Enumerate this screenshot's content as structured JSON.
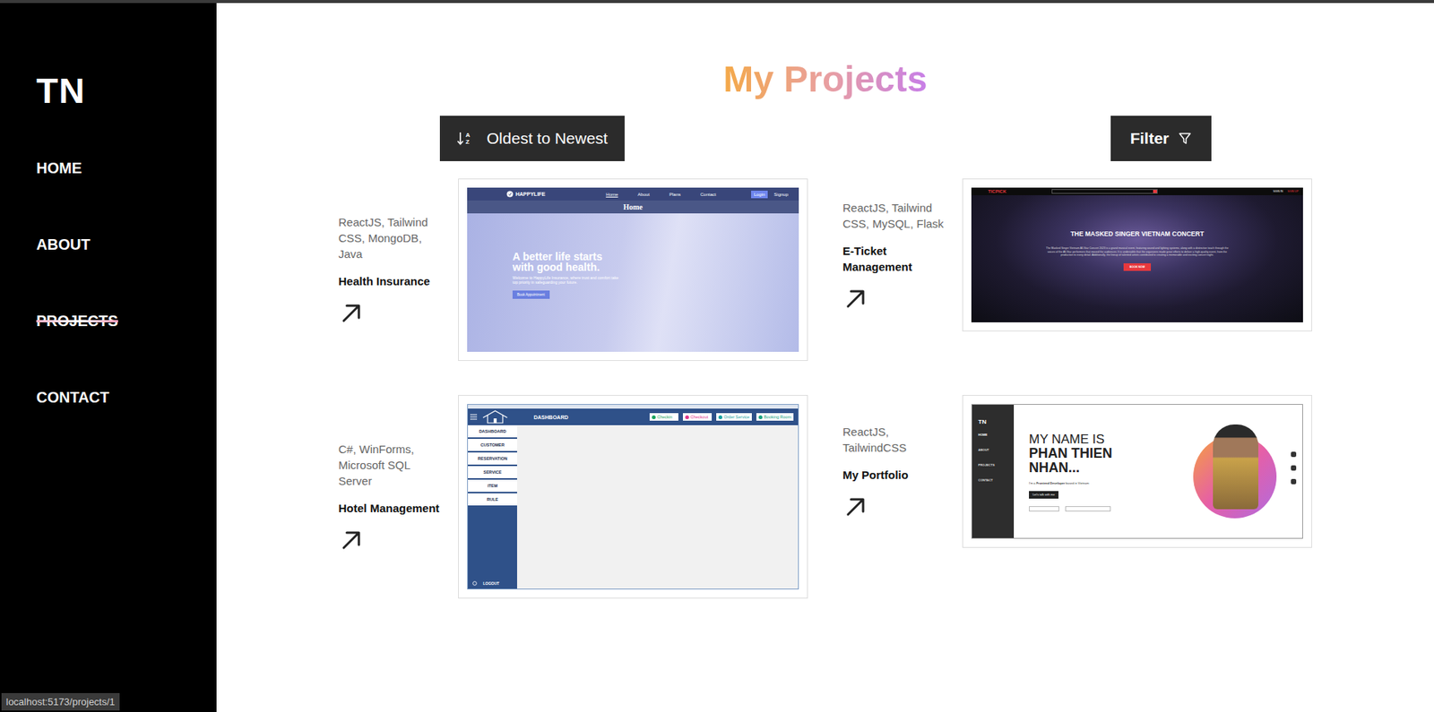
{
  "sidebar": {
    "logo": "TN",
    "items": [
      {
        "label": "HOME",
        "selected": false
      },
      {
        "label": "ABOUT",
        "selected": false
      },
      {
        "label": "PROJECTS",
        "selected": true
      },
      {
        "label": "CONTACT",
        "selected": false
      }
    ]
  },
  "title": "My Projects",
  "sort": {
    "icon_letters": [
      "A",
      "Z"
    ],
    "label": "Oldest to Newest"
  },
  "filter": {
    "label": "Filter"
  },
  "projects": [
    {
      "tech": "ReactJS, Tailwind CSS, MongoDB, Java",
      "name": "Health Insurance",
      "preview": {
        "kind": "health",
        "brand": "HAPPYLIFE",
        "nav": [
          {
            "label": "Home",
            "selected": true
          },
          {
            "label": "About",
            "selected": false
          },
          {
            "label": "Plans",
            "selected": false
          },
          {
            "label": "Contact",
            "selected": false
          }
        ],
        "login": "Login",
        "signup": "Signup",
        "banner": "Home",
        "headline": "A better life starts with good health.",
        "text": "Welcome to HappyLife Insurance, where trust and comfort take top priority in safeguarding your future.",
        "button": "Book Appointment"
      }
    },
    {
      "tech": "ReactJS, Tailwind CSS, MySQL, Flask",
      "name": "E-Ticket Management",
      "preview": {
        "kind": "ticket",
        "brand": "TICPICK",
        "links": [
          "SIGN IN",
          "SIGN UP"
        ],
        "headline": "THE MASKED SINGER VIETNAM CONCERT",
        "text": "The Masked Singer Vietnam All-Star Concert 2023 is a grand musical event, featuring sound and lighting systems, along with a distinctive touch through the voices of the All-Star performers that moved the audiences. It is undeniable that the organizers made great efforts to deliver a high-quality event, from the production to every detail. Additionally, the lineup of talented artists contributed to creating a memorable and exciting concert night.",
        "button": "BOOK NOW"
      }
    },
    {
      "tech": "C#, WinForms, Microsoft SQL Server",
      "name": "Hotel Management",
      "preview": {
        "kind": "desktop",
        "header": "DASHBOARD",
        "actions": [
          {
            "label": "Checkin",
            "color": "#1aa35c"
          },
          {
            "label": "Checkout",
            "color": "#e0368a"
          },
          {
            "label": "Order Service",
            "color": "#17a2a0"
          },
          {
            "label": "Booking Room",
            "color": "#17a27e"
          }
        ],
        "menu": [
          "DASHBOARD",
          "CUSTOMER",
          "RESERVATION",
          "SERVICE",
          "ITEM",
          "RULE"
        ],
        "logout": "LOGOUT"
      }
    },
    {
      "tech": "ReactJS, TailwindCSS",
      "name": "My Portfolio",
      "preview": {
        "kind": "portfolio",
        "logo": "TN",
        "nav": [
          {
            "label": "HOME",
            "selected": true
          },
          {
            "label": "ABOUT",
            "selected": false
          },
          {
            "label": "PROJECTS",
            "selected": false
          },
          {
            "label": "CONTACT",
            "selected": false
          }
        ],
        "greeting": "MY NAME IS",
        "name": "PHAN THIEN NHAN...",
        "intro_prefix": "I'm a ",
        "role": "Frontend Developer",
        "intro_suffix": " based in Vietnam",
        "button": "Let's talk with me"
      }
    }
  ],
  "status_bar": "localhost:5173/projects/1"
}
